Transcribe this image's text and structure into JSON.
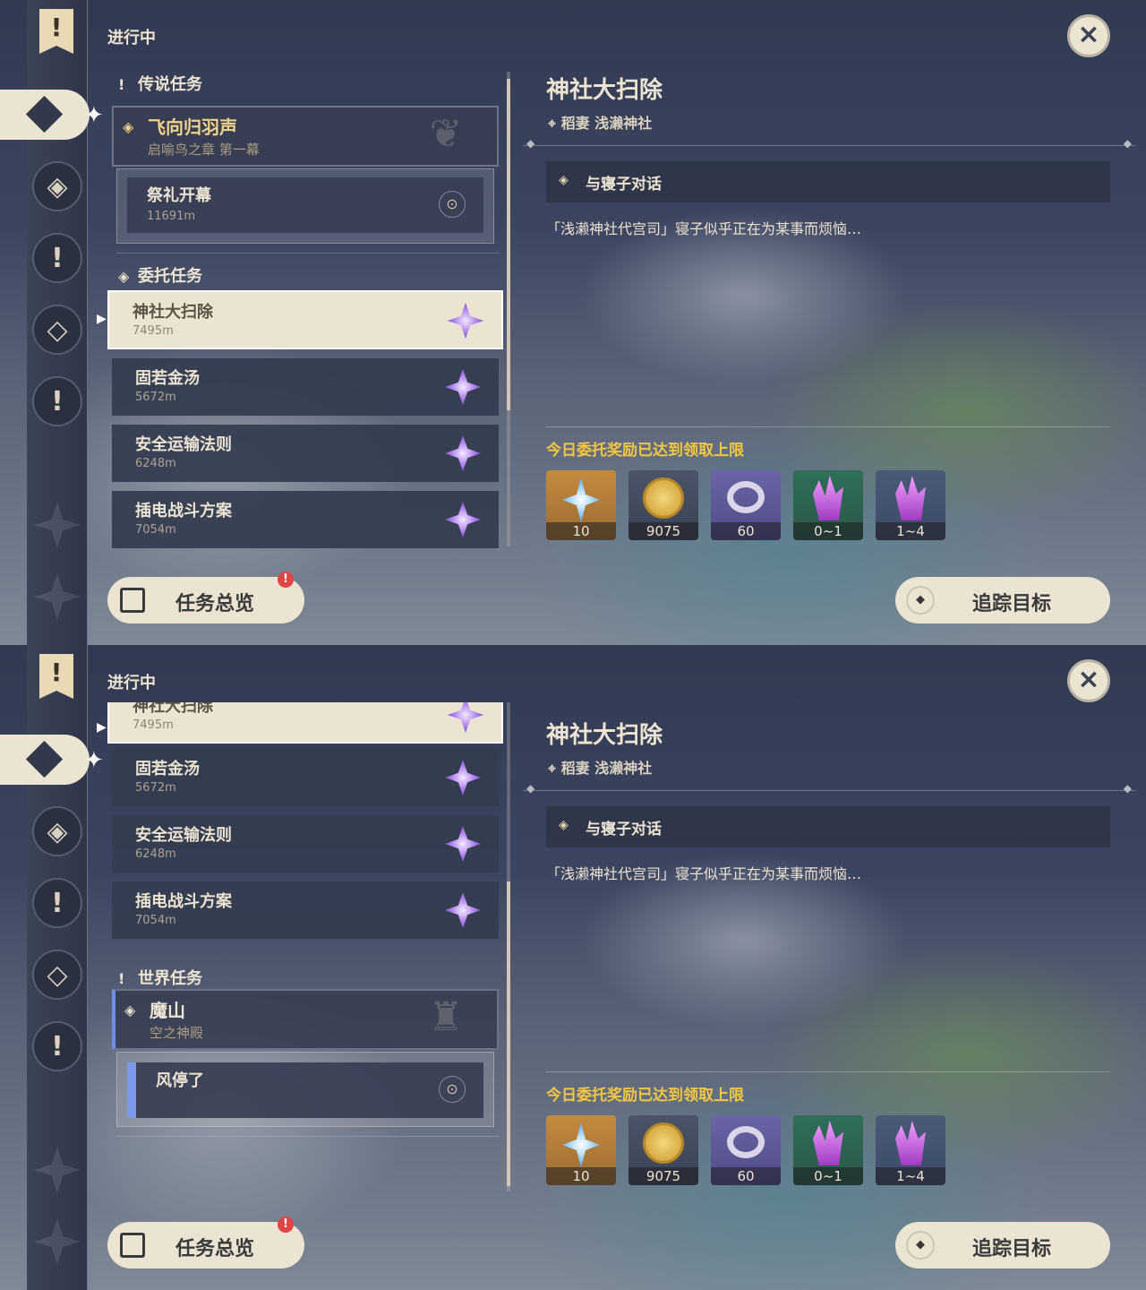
{
  "screens": [
    {
      "header": "进行中",
      "legend_section": "传说任务",
      "legend": {
        "title": "飞向归羽声",
        "subtitle": "启喻鸟之章 第一幕"
      },
      "legend_sub": {
        "title": "祭礼开幕",
        "distance": "11691m"
      },
      "commission_section": "委托任务",
      "tasks": [
        {
          "title": "神社大扫除",
          "distance": "7495m"
        },
        {
          "title": "固若金汤",
          "distance": "5672m"
        },
        {
          "title": "安全运输法则",
          "distance": "6248m"
        },
        {
          "title": "插电战斗方案",
          "distance": "7054m"
        }
      ]
    },
    {
      "header": "进行中",
      "tasks": [
        {
          "title": "神社大扫除",
          "distance": "7495m"
        },
        {
          "title": "固若金汤",
          "distance": "5672m"
        },
        {
          "title": "安全运输法则",
          "distance": "6248m"
        },
        {
          "title": "插电战斗方案",
          "distance": "7054m"
        }
      ],
      "world_section": "世界任务",
      "world": {
        "title": "魔山",
        "subtitle": "空之神殿"
      },
      "world_sub": {
        "title": "风停了"
      }
    }
  ],
  "detail": {
    "title": "神社大扫除",
    "location": "稻妻 浅濑神社",
    "objective": "与寝子对话",
    "description": "「浅濑神社代宫司」寝子似乎正在为某事而烦恼…",
    "reward_title": "今日委托奖励已达到领取上限",
    "rewards": [
      "10",
      "9075",
      "60",
      "0~1",
      "1~4"
    ]
  },
  "buttons": {
    "overview": "任务总览",
    "track": "追踪目标",
    "badge": "!"
  },
  "icons": {
    "close": "×"
  },
  "colors": {
    "accent": "#f3c742",
    "selected": "#ece4d3",
    "world_marker": "#6f8ee8"
  }
}
